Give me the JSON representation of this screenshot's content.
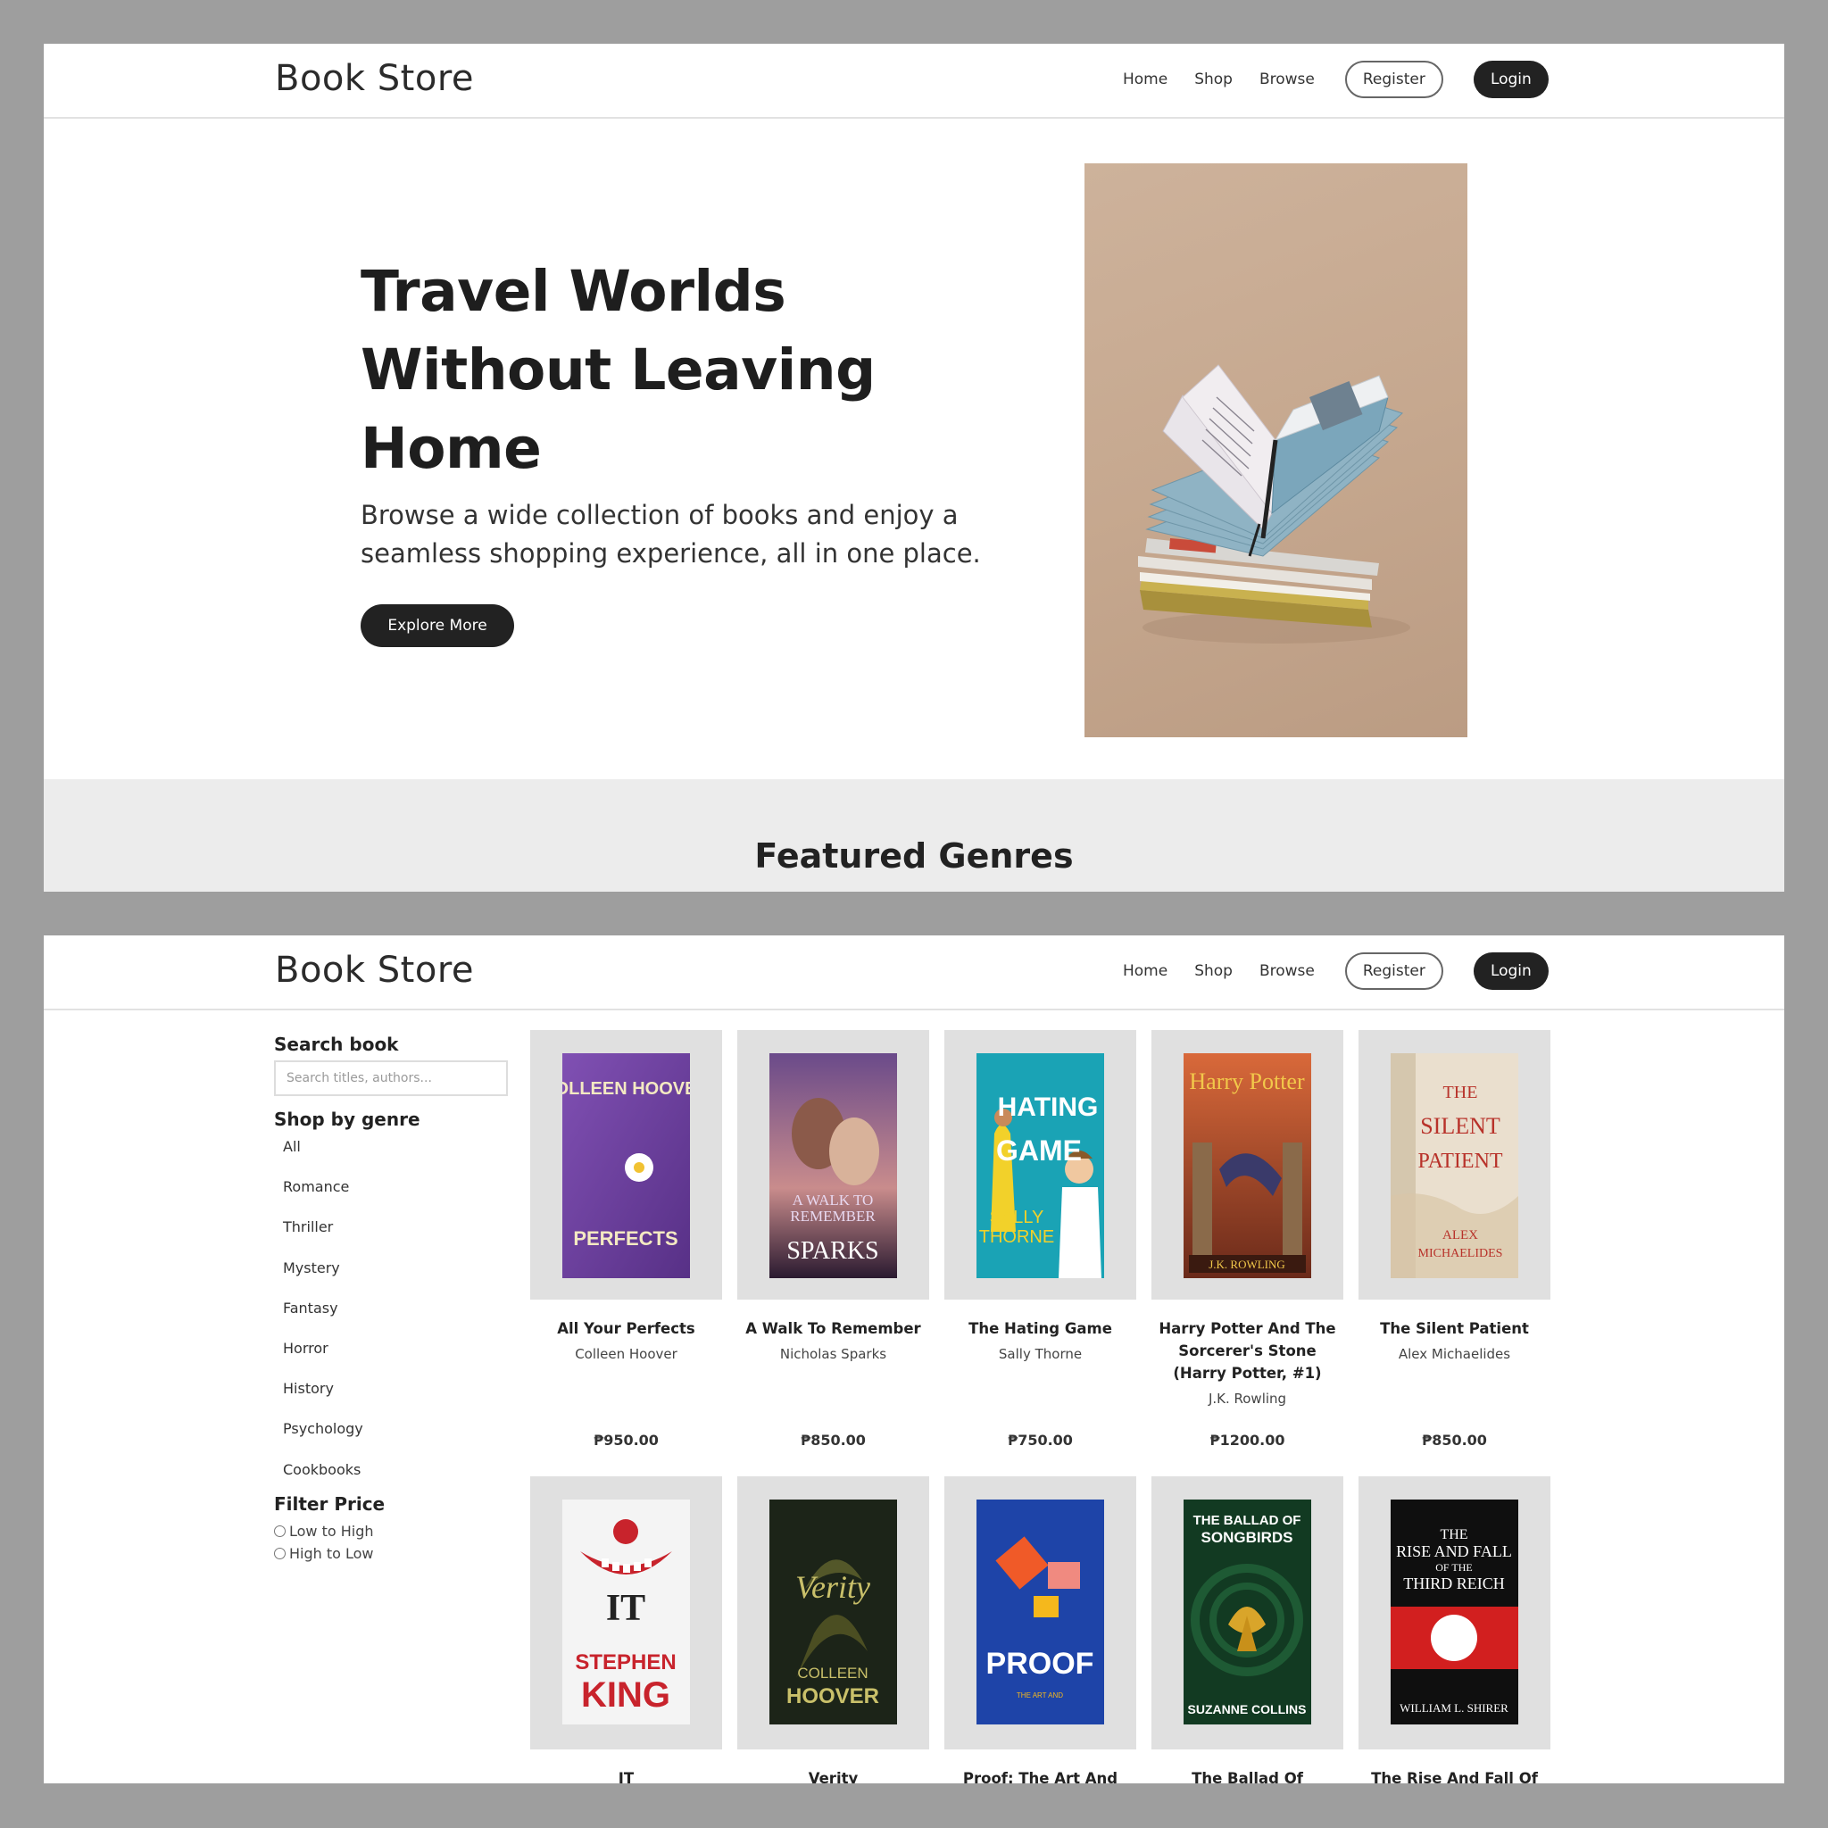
{
  "nav": {
    "brand": "Book Store",
    "links": [
      "Home",
      "Shop",
      "Browse"
    ],
    "register": "Register",
    "login": "Login"
  },
  "hero": {
    "title": "Travel Worlds Without Leaving Home",
    "subtitle": "Browse a wide collection of books and enjoy a seamless shopping experience, all in one place.",
    "cta": "Explore More"
  },
  "featured": {
    "title": "Featured Genres"
  },
  "sidebar": {
    "search_heading": "Search book",
    "search_placeholder": "Search titles, authors...",
    "genre_heading": "Shop by genre",
    "genres": [
      "All",
      "Romance",
      "Thriller",
      "Mystery",
      "Fantasy",
      "Horror",
      "History",
      "Psychology",
      "Cookbooks"
    ],
    "filter_heading": "Filter Price",
    "filter_options": [
      "Low to High",
      "High to Low"
    ]
  },
  "books": [
    {
      "title": "All Your Perfects",
      "author": "Colleen Hoover",
      "price": "₱950.00",
      "cover_color": "#6b3fa0",
      "cover_text": "COLLEEN HOOVER"
    },
    {
      "title": "A Walk To Remember",
      "author": "Nicholas Sparks",
      "price": "₱850.00",
      "cover_color": "#3c2a5a",
      "cover_text": "SPARKS"
    },
    {
      "title": "The Hating Game",
      "author": "Sally Thorne",
      "price": "₱750.00",
      "cover_color": "#1aa3b5",
      "cover_text": "THE HATING GAME"
    },
    {
      "title": "Harry Potter And The Sorcerer's Stone (Harry Potter, #1)",
      "author": "J.K. Rowling",
      "price": "₱1200.00",
      "cover_color": "#b44a2a",
      "cover_text": "Harry Potter"
    },
    {
      "title": "The Silent Patient",
      "author": "Alex Michaelides",
      "price": "₱850.00",
      "cover_color": "#eadfce",
      "cover_text": "THE SILENT PATIENT"
    },
    {
      "title": "IT",
      "author": "",
      "price": "",
      "cover_color": "#f4f4f4",
      "cover_text": "STEPHEN KING"
    },
    {
      "title": "Verity",
      "author": "",
      "price": "",
      "cover_color": "#1c2418",
      "cover_text": "COLLEEN HOOVER"
    },
    {
      "title": "Proof: The Art And",
      "author": "",
      "price": "",
      "cover_color": "#1e44a8",
      "cover_text": "PROOF"
    },
    {
      "title": "The Ballad Of Songbirds",
      "author": "",
      "price": "",
      "cover_color": "#123a22",
      "cover_text": "SUZANNE COLLINS"
    },
    {
      "title": "The Rise And Fall Of The",
      "author": "",
      "price": "",
      "cover_color": "#0f0f0f",
      "cover_text": "THIRD REICH"
    }
  ]
}
